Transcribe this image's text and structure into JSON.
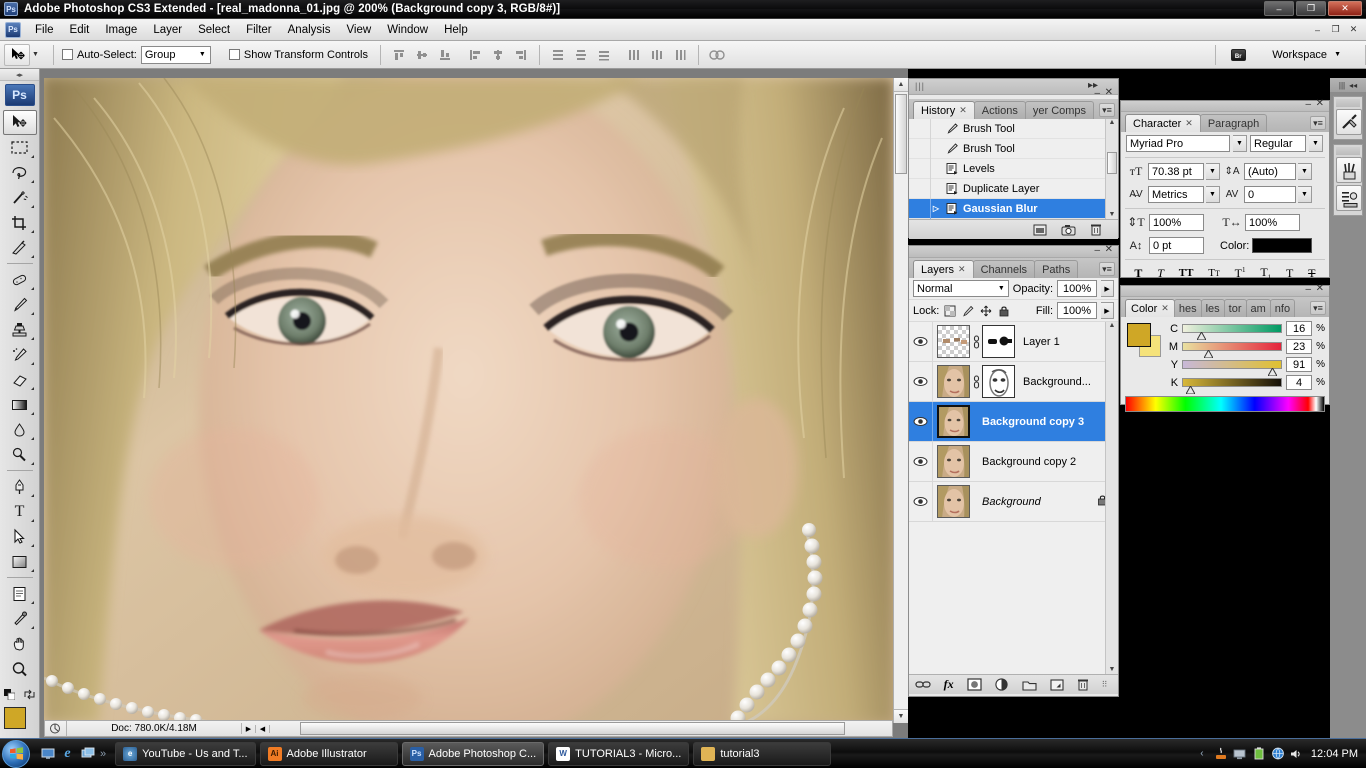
{
  "window": {
    "title": "Adobe Photoshop CS3 Extended - [real_madonna_01.jpg @ 200% (Background copy 3, RGB/8#)]",
    "app_badge": "Ps",
    "minimize": "–",
    "maximize": "❐",
    "close": "✕",
    "doc_minimize": "–",
    "doc_maximize": "❐",
    "doc_close": "✕"
  },
  "menubar": {
    "items": [
      {
        "label": "File"
      },
      {
        "label": "Edit"
      },
      {
        "label": "Image"
      },
      {
        "label": "Layer"
      },
      {
        "label": "Select"
      },
      {
        "label": "Filter"
      },
      {
        "label": "Analysis"
      },
      {
        "label": "View"
      },
      {
        "label": "Window"
      },
      {
        "label": "Help"
      }
    ]
  },
  "options_bar": {
    "tool_icon": "move-tool",
    "auto_select_label": "Auto-Select:",
    "auto_select_value": "Group",
    "show_transform_label": "Show Transform Controls",
    "bridge_label": "Br",
    "workspace_label": "Workspace"
  },
  "toolbox": {
    "tools": [
      {
        "name": "move-tool",
        "active": true
      },
      {
        "name": "rectangular-marquee-tool",
        "active": false
      },
      {
        "name": "lasso-tool",
        "active": false
      },
      {
        "name": "magic-wand-tool",
        "active": false
      },
      {
        "name": "crop-tool",
        "active": false
      },
      {
        "name": "slice-tool",
        "active": false
      },
      {
        "name": "healing-brush-tool",
        "active": false
      },
      {
        "name": "brush-tool",
        "active": false
      },
      {
        "name": "clone-stamp-tool",
        "active": false
      },
      {
        "name": "history-brush-tool",
        "active": false
      },
      {
        "name": "eraser-tool",
        "active": false
      },
      {
        "name": "gradient-tool",
        "active": false
      },
      {
        "name": "blur-tool",
        "active": false
      },
      {
        "name": "dodge-tool",
        "active": false
      },
      {
        "name": "pen-tool",
        "active": false
      },
      {
        "name": "type-tool",
        "active": false
      },
      {
        "name": "path-selection-tool",
        "active": false
      },
      {
        "name": "shape-tool",
        "active": false
      },
      {
        "name": "notes-tool",
        "active": false
      },
      {
        "name": "eyedropper-tool",
        "active": false
      },
      {
        "name": "hand-tool",
        "active": false
      },
      {
        "name": "zoom-tool",
        "active": false
      }
    ],
    "foreground_color": "#cfa726",
    "background_color": "#f2df72"
  },
  "document": {
    "zoom": "200%",
    "status": "Doc: 780.0K/4.18M"
  },
  "history_panel": {
    "tabs": [
      {
        "label": "History",
        "active": true,
        "closable": true
      },
      {
        "label": "Actions",
        "active": false,
        "closable": false
      },
      {
        "label": "yer Comps",
        "active": false,
        "closable": false
      }
    ],
    "items": [
      {
        "label": "Brush Tool",
        "icon": "brush-icon",
        "selected": false
      },
      {
        "label": "Brush Tool",
        "icon": "brush-icon",
        "selected": false
      },
      {
        "label": "Levels",
        "icon": "adjustment-icon",
        "selected": false
      },
      {
        "label": "Duplicate Layer",
        "icon": "adjustment-icon",
        "selected": false
      },
      {
        "label": "Gaussian Blur",
        "icon": "adjustment-icon",
        "selected": true
      }
    ],
    "buttons": [
      "new-document-icon",
      "new-snapshot-icon",
      "delete-icon"
    ]
  },
  "layers_panel": {
    "tabs": [
      {
        "label": "Layers",
        "active": true,
        "closable": true
      },
      {
        "label": "Channels",
        "active": false,
        "closable": false
      },
      {
        "label": "Paths",
        "active": false,
        "closable": false
      }
    ],
    "blend_mode": "Normal",
    "opacity_label": "Opacity:",
    "opacity_value": "100%",
    "lock_label": "Lock:",
    "fill_label": "Fill:",
    "fill_value": "100%",
    "layers": [
      {
        "name": "Layer 1",
        "selected": false,
        "has_mask": true,
        "thumb": "checker",
        "locked": false,
        "italic": false
      },
      {
        "name": "Background...",
        "selected": false,
        "has_mask": true,
        "thumb": "photo",
        "locked": false,
        "italic": false
      },
      {
        "name": "Background copy 3",
        "selected": true,
        "has_mask": false,
        "thumb": "photo",
        "locked": false,
        "italic": false
      },
      {
        "name": "Background copy 2",
        "selected": false,
        "has_mask": false,
        "thumb": "photo",
        "locked": false,
        "italic": false
      },
      {
        "name": "Background",
        "selected": false,
        "has_mask": false,
        "thumb": "photo",
        "locked": true,
        "italic": true
      }
    ],
    "buttons": [
      "link-layers-icon",
      "add-style-icon",
      "add-mask-icon",
      "adjustment-layer-icon",
      "new-group-icon",
      "new-layer-icon",
      "delete-layer-icon"
    ]
  },
  "character_panel": {
    "tabs": [
      {
        "label": "Character",
        "active": true,
        "closable": true
      },
      {
        "label": "Paragraph",
        "active": false,
        "closable": false
      }
    ],
    "font_family": "Myriad Pro",
    "font_style": "Regular",
    "font_size": "70.38 pt",
    "leading": "(Auto)",
    "kerning": "Metrics",
    "tracking": "0",
    "vertical_scale": "100%",
    "horizontal_scale": "100%",
    "baseline_shift": "0 pt",
    "color_label": "Color:",
    "color_value": "#000000",
    "style_buttons": [
      "bold",
      "italic",
      "all-caps",
      "small-caps",
      "superscript",
      "subscript",
      "underline",
      "strikethrough"
    ]
  },
  "color_panel": {
    "tabs": [
      {
        "label": "Color",
        "active": true,
        "closable": true
      },
      {
        "label": "hes",
        "active": false,
        "closable": false
      },
      {
        "label": "les",
        "active": false,
        "closable": false
      },
      {
        "label": "tor",
        "active": false,
        "closable": false
      },
      {
        "label": "am",
        "active": false,
        "closable": false
      },
      {
        "label": "nfo",
        "active": false,
        "closable": false
      }
    ],
    "foreground_color": "#cfa726",
    "background_color": "#f5e27a",
    "channels": [
      {
        "label": "C",
        "value": "16",
        "unit": "%",
        "pos": 16,
        "grad_from": "#f0f0dd",
        "grad_to": "#009a63"
      },
      {
        "label": "M",
        "value": "23",
        "unit": "%",
        "pos": 23,
        "grad_from": "#e8e0a0",
        "grad_to": "#e5243c"
      },
      {
        "label": "Y",
        "value": "91",
        "unit": "%",
        "pos": 91,
        "grad_from": "#c8b8d8",
        "grad_to": "#e0c030"
      },
      {
        "label": "K",
        "value": "4",
        "unit": "%",
        "pos": 4,
        "grad_from": "#d8b83a",
        "grad_to": "#151008"
      }
    ]
  },
  "icon_dock": {
    "buttons": [
      {
        "name": "tool-presets-icon"
      },
      {
        "name": "brushes-icon"
      },
      {
        "name": "layer-comps-icon"
      }
    ]
  },
  "taskbar": {
    "start": "start-orb",
    "quick_launch": [
      "show-desktop-icon",
      "internet-explorer-icon",
      "switch-windows-icon"
    ],
    "overflow": "»",
    "tasks": [
      {
        "label": "YouTube - Us and T...",
        "icon": "ie-icon",
        "icon_color": "#3a6ea5",
        "icon_text": "e",
        "active": false
      },
      {
        "label": "Adobe Illustrator",
        "icon": "ai-icon",
        "icon_color": "#f07b24",
        "icon_text": "Ai",
        "active": false
      },
      {
        "label": "Adobe Photoshop C...",
        "icon": "ps-icon",
        "icon_color": "#2a5fa5",
        "icon_text": "Ps",
        "active": true
      },
      {
        "label": "TUTORIAL3 - Micro...",
        "icon": "word-icon",
        "icon_color": "#2b579a",
        "icon_text": "W",
        "active": false
      },
      {
        "label": "tutorial3",
        "icon": "folder-icon",
        "icon_color": "#d8a842",
        "icon_text": "",
        "active": false
      }
    ],
    "tray_icons": [
      "tray-chevron",
      "java-icon",
      "display-icon",
      "battery-icon",
      "network-icon",
      "volume-icon"
    ],
    "clock": "12:04 PM"
  }
}
